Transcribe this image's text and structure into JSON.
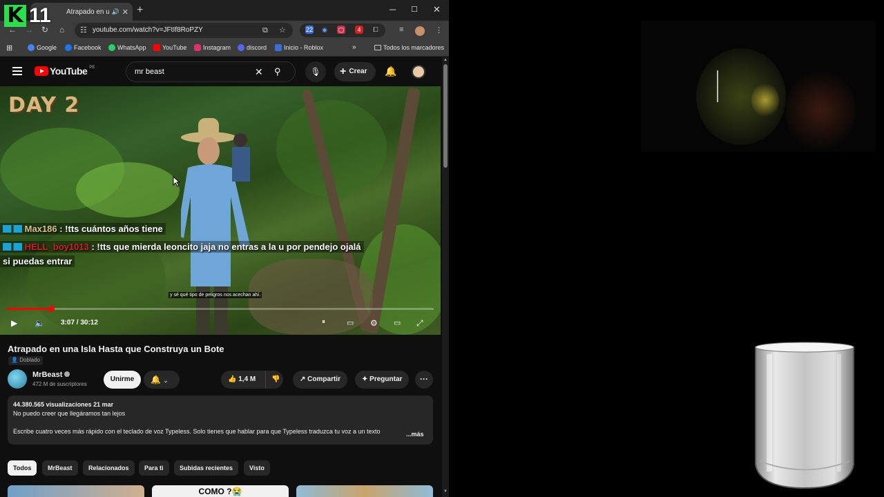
{
  "overlay_logo": {
    "letter": "K",
    "number": "11"
  },
  "browser": {
    "tab_title": "Atrapado en una Isla Hasta",
    "url": "youtube.com/watch?v=JFtIf8RoPZY",
    "bookmarks": [
      {
        "label": "Google",
        "color": "#4285f4"
      },
      {
        "label": "Facebook",
        "color": "#1877f2"
      },
      {
        "label": "WhatsApp",
        "color": "#25d366"
      },
      {
        "label": "YouTube",
        "color": "#ff0000"
      },
      {
        "label": "Instagram",
        "color": "#e1306c"
      },
      {
        "label": "discord",
        "color": "#5865f2"
      },
      {
        "label": "Inicio - Roblox",
        "color": "#3b6fd6"
      }
    ],
    "all_bookmarks": "Todos los marcadores",
    "ext_badges": [
      "22",
      "4"
    ]
  },
  "youtube": {
    "logo_text": "YouTube",
    "region": "PE",
    "search_value": "mr beast",
    "create_label": "Crear"
  },
  "video": {
    "overlay_title": "DAY 2",
    "chat": [
      {
        "user": "Max186",
        "message": " : !tts cuántos años tiene"
      },
      {
        "user": "HELL_boy1013",
        "message": " : !tts que mierda leoncito jaja no entras a la u por pendejo ojalá",
        "continuation": "si puedas entrar"
      }
    ],
    "subtitle": "y sé qué tipo de peligros nos acechan ahí.",
    "time": "3:07 / 30:12",
    "progress": 0.103
  },
  "info": {
    "title": "Atrapado en una Isla Hasta que Construya un Bote",
    "dubbed": "Doblado",
    "channel": "MrBeast",
    "subscribers": "472 M de suscriptores",
    "join": "Unirme",
    "likes": "1,4 M",
    "share": "Compartir",
    "ask": "Preguntar",
    "views_date": "44.380.565 visualizaciones  21 mar",
    "desc_line1": "No puedo creer que llegáramos tan lejos",
    "desc_line2": "Escribe cuatro veces más rápido con el teclado de voz Typeless. Solo tienes que hablar para que Typeless traduzca tu voz a un texto",
    "more": "...más"
  },
  "chips": [
    "Todos",
    "MrBeast",
    "Relacionados",
    "Para ti",
    "Subidas recientes",
    "Visto"
  ],
  "thumbnails": [
    "",
    "COMO ?😭",
    ""
  ]
}
